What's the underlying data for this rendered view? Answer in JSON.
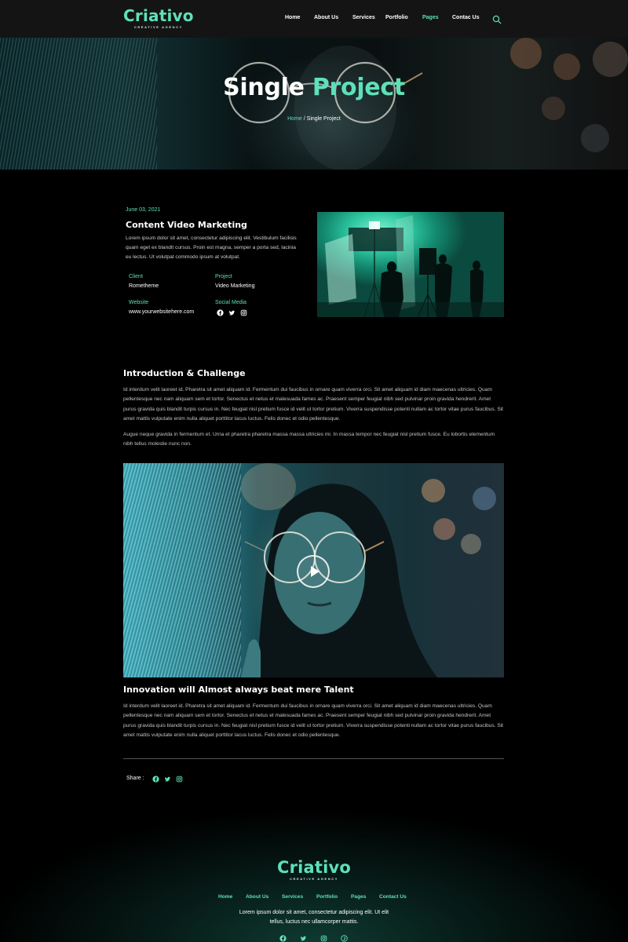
{
  "brand": {
    "name": "Criativo",
    "tagline": "CREATIVE AGENCY",
    "accent_color": "#5ee0b8"
  },
  "nav": {
    "items": [
      {
        "label": "Home"
      },
      {
        "label": "About Us"
      },
      {
        "label": "Services"
      },
      {
        "label": "Portfolio"
      },
      {
        "label": "Pages",
        "active": true
      },
      {
        "label": "Contac Us"
      }
    ],
    "search_icon": "search-icon"
  },
  "hero": {
    "title_part1": "Single",
    "title_part2": "Project",
    "breadcrumb_home": "Home",
    "breadcrumb_sep": " / ",
    "breadcrumb_current": "Single Project"
  },
  "project": {
    "date": "June 03, 2021",
    "title": "Content Video Marketing",
    "description": "Lorem ipsum dolor sit amet, consectetur adipiscing elit. Vestibulum facilisis quam eget ex blandit cursus. Proin est magna, semper a porta sed, lacinia eu lectus. Ut volutpat commodo ipsum at volutpat.",
    "meta": {
      "client_label": "Client",
      "client_value": "Rometheme",
      "project_label": "Project",
      "project_value": "Video Marketing",
      "website_label": "Website",
      "website_value": "www.yourwebsitehere.com",
      "social_label": "Social Media"
    },
    "social_icons": [
      "facebook-icon",
      "twitter-icon",
      "instagram-icon"
    ]
  },
  "intro": {
    "title": "Introduction & Challenge",
    "para1": "Id interdum velit laoreet id. Pharetra sit amet aliquam id. Fermentum dui faucibus in ornare quam viverra orci. Sit amet aliquam id diam maecenas ultricies. Quam pellentesque nec nam aliquam sem et tortor. Senectus et netus et malesuada fames ac. Praesent semper feugiat nibh sed pulvinar proin gravida hendrerit. Amet purus gravida quis blandit turpis cursus in. Nec feugiat nisl pretium fusce id velit ut tortor pretium. Viverra suspendisse potenti nullam ac tortor vitae purus faucibus. Sit amet mattis vulputate enim nulla aliquet porttitor lacus luctus. Felis donec et odio pellentesque.",
    "para2": "Augue neque gravida in fermentum et. Urna et pharetra pharetra massa massa ultricies mi. In massa tempor nec feugiat nisl pretium fusce. Eu lobortis elementum nibh tellus molestie nunc non."
  },
  "innovation": {
    "title": "Innovation will Almost always beat mere Talent",
    "para": "Id interdum velit laoreet id. Pharetra sit amet aliquam id. Fermentum dui faucibus in ornare quam viverra orci. Sit amet aliquam id diam maecenas ultricies. Quam pellentesque nec nam aliquam sem et tortor. Senectus et netus et malesuada fames ac. Praesent semper feugiat nibh sed pulvinar proin gravida hendrerit. Amet purus gravida quis blandit turpis cursus in. Nec feugiat nisl pretium fusce id velit ut tortor pretium. Viverra suspendisse potenti nullam ac tortor vitae purus faucibus. Sit amet mattis vulputate enim nulla aliquet porttitor lacus luctus. Felis donec et odio pellentesque."
  },
  "share": {
    "label": "Share :"
  },
  "footer": {
    "nav": [
      {
        "label": "Home"
      },
      {
        "label": "About Us"
      },
      {
        "label": "Services"
      },
      {
        "label": "Portfolio"
      },
      {
        "label": "Pages"
      },
      {
        "label": "Contact Us"
      }
    ],
    "text": "Lorem ipsum dolor sit amet, consectetur adipiscing elit. Ut elit tellus, luctus nec ullamcorper mattis.",
    "social_icons": [
      "facebook-icon",
      "twitter-icon",
      "instagram-icon",
      "pinterest-icon"
    ]
  }
}
